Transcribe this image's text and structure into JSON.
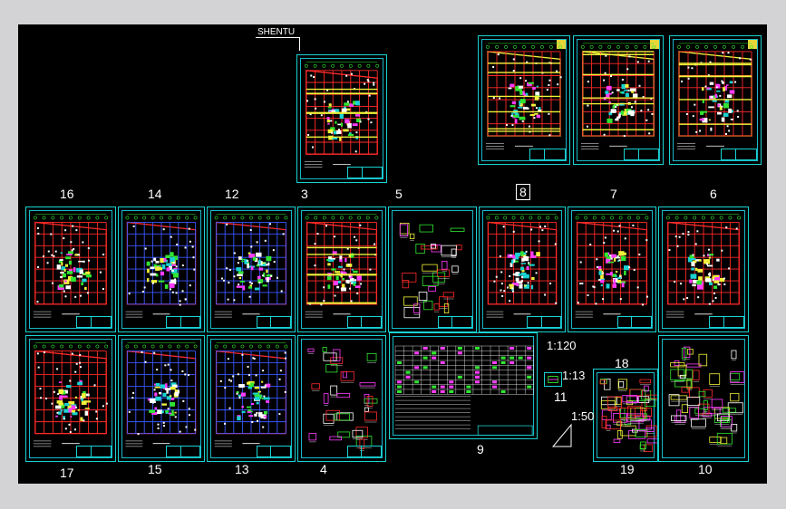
{
  "canvas": {
    "background": "#000000",
    "frame": "#d3d3d6",
    "sheet_border": "#19d3d3"
  },
  "colors": {
    "cyan": "#19d3d3",
    "red": "#ff2a2a",
    "yellow": "#f2f23a",
    "green": "#31e631",
    "magenta": "#ff3cff",
    "blue": "#3a56ff",
    "white": "#ffffff"
  },
  "labels": {
    "shentu": "SHENTU",
    "s16": "16",
    "s14": "14",
    "s12": "12",
    "s3": "3",
    "s5": "5",
    "s8": "8",
    "s7": "7",
    "s6": "6",
    "s17": "17",
    "s15": "15",
    "s13": "13",
    "s4": "4",
    "s9": "9",
    "s11": "11",
    "s18": "18",
    "s19": "19",
    "s10": "10",
    "scale_120": "1:120",
    "scale_13": "1:13",
    "scale_50": "1:50"
  }
}
